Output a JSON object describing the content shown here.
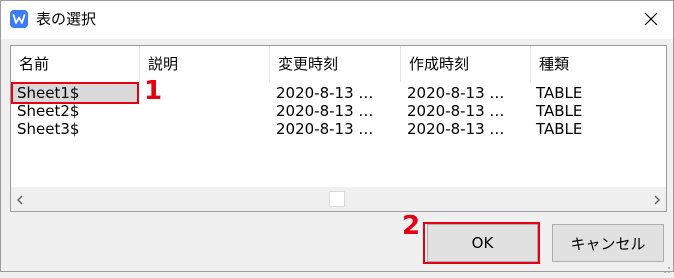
{
  "window": {
    "title": "表の選択"
  },
  "table": {
    "columns": [
      "名前",
      "説明",
      "変更時刻",
      "作成時刻",
      "種類"
    ],
    "rows": [
      {
        "name": "Sheet1$",
        "description": "",
        "modified": "2020-8-13 …",
        "created": "2020-8-13 …",
        "type": "TABLE",
        "selected": true
      },
      {
        "name": "Sheet2$",
        "description": "",
        "modified": "2020-8-13 …",
        "created": "2020-8-13 …",
        "type": "TABLE",
        "selected": false
      },
      {
        "name": "Sheet3$",
        "description": "",
        "modified": "2020-8-13 …",
        "created": "2020-8-13 …",
        "type": "TABLE",
        "selected": false
      }
    ],
    "scroll_position": 0.48
  },
  "buttons": {
    "ok": "OK",
    "cancel": "キャンセル"
  },
  "annotations": {
    "step1": "1",
    "step2": "2"
  },
  "colors": {
    "highlight": "#e60012",
    "selection": "#d9d9d9",
    "app_icon": "#3b7cf6"
  },
  "icons": {
    "app": "wps-w-icon",
    "close": "close-icon",
    "left": "chevron-left-icon",
    "right": "chevron-right-icon"
  }
}
